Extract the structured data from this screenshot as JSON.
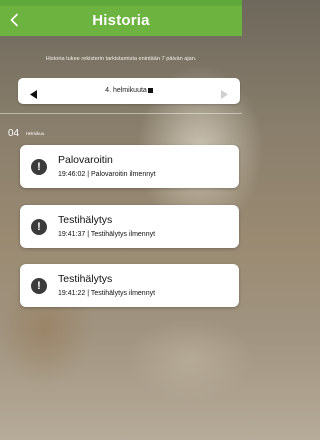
{
  "header": {
    "title": "Historia"
  },
  "notice": "Historia tukee rekisterin tarkistamista enintään 7 päivän ajan.",
  "datebar": {
    "date_label": "4. helmikuuta"
  },
  "day_group": {
    "day": "04",
    "month": "Helmikuu"
  },
  "events": [
    {
      "title": "Palovaroitin",
      "time": "19:46:02",
      "detail": "Palovaroitin ilmennyt"
    },
    {
      "title": "Testihälytys",
      "time": "19:41:37",
      "detail": "Testihälytys ilmennyt"
    },
    {
      "title": "Testihälytys",
      "time": "19:41:22",
      "detail": "Testihälytys ilmennyt"
    }
  ],
  "colors": {
    "header_bg": "#6cb33f",
    "badge_bg": "#3b3b3b",
    "card_bg": "#ffffff"
  },
  "icons": {
    "back": "chevron-left-icon",
    "prev": "triangle-left-icon",
    "next": "triangle-right-icon",
    "calendar": "calendar-icon",
    "alert": "exclamation-icon"
  }
}
